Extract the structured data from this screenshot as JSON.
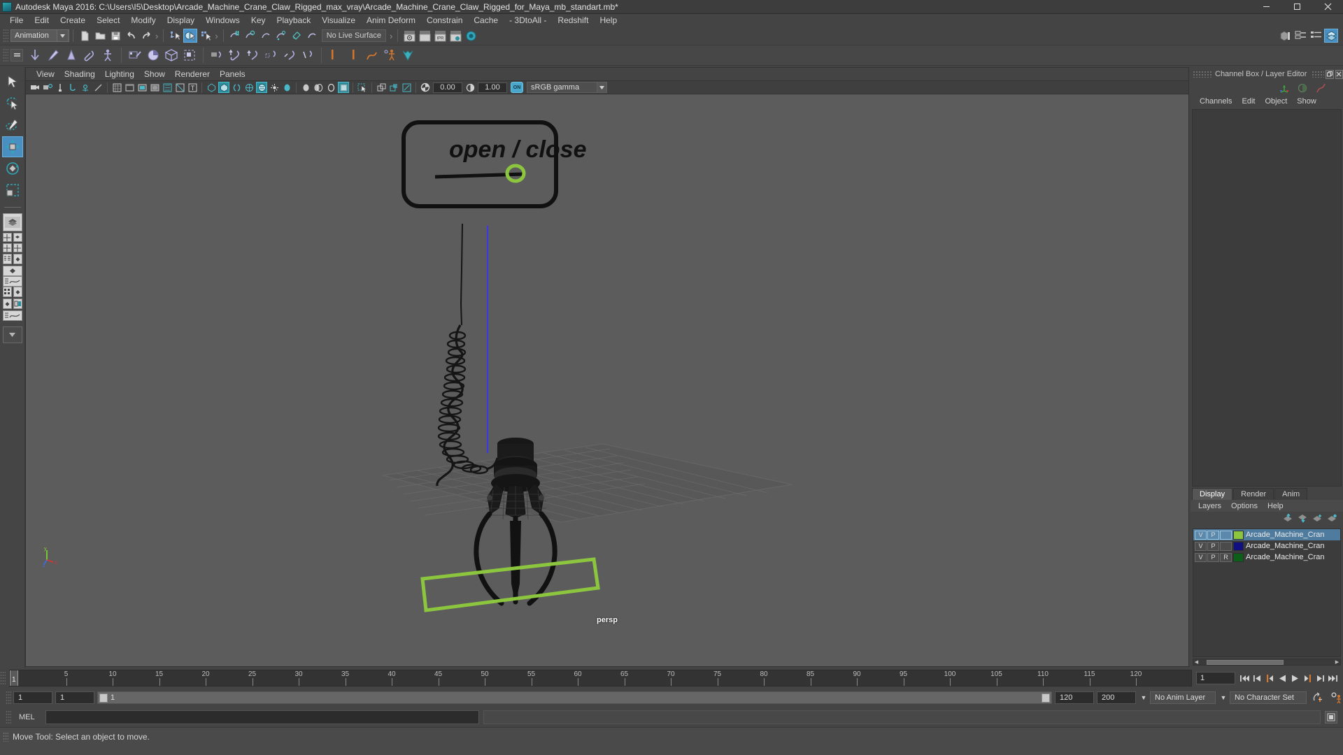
{
  "window": {
    "title": "Autodesk Maya 2016: C:\\Users\\I5\\Desktop\\Arcade_Machine_Crane_Claw_Rigged_max_vray\\Arcade_Machine_Crane_Claw_Rigged_for_Maya_mb_standart.mb*",
    "app_icon": "maya-logo-icon",
    "minimize_label": "–",
    "maximize_label": "❑",
    "close_label": "✕"
  },
  "menubar": {
    "items": [
      "File",
      "Edit",
      "Create",
      "Select",
      "Modify",
      "Display",
      "Windows",
      "Key",
      "Playback",
      "Visualize",
      "Anim Deform",
      "Constrain",
      "Cache",
      "- 3DtoAll -",
      "Redshift",
      "Help"
    ]
  },
  "toolbar": {
    "menu_set": "Animation",
    "live_surface": "No Live Surface",
    "file_icons": [
      "new-scene-icon",
      "open-scene-icon",
      "save-scene-icon",
      "undo-icon",
      "redo-icon"
    ],
    "select_mode_icons": [
      "select-by-hierarchy-icon",
      "select-by-object-icon",
      "select-by-component-icon"
    ],
    "snap_icons": [
      "snap-to-grid-icon",
      "snap-to-curve-icon",
      "snap-to-point-icon",
      "snap-to-projected-center-icon",
      "snap-to-view-plane-icon",
      "make-live-icon"
    ],
    "render_icons": [
      "render-current-frame-icon",
      "render-sequence-icon",
      "ipr-render-icon",
      "render-settings-icon",
      "hypershade-icon"
    ],
    "right_icons": [
      "show-hide-modeling-toolkit-icon",
      "show-hide-attribute-editor-icon",
      "show-hide-tool-settings-icon",
      "show-hide-channel-box-icon"
    ]
  },
  "shelf": {
    "tab_icon": "shelf-tabs-icon",
    "icons": [
      "move-down-arrow-icon",
      "paint-brush-icon",
      "cone-deform-icon",
      "clip-icon",
      "skeleton-icon",
      "set-key-icon",
      "pie-chart-icon",
      "cube-wire-icon",
      "bounding-box-icon",
      "parent-constraint-icon",
      "point-constraint-icon",
      "orient-constraint-icon",
      "scale-constraint-icon",
      "aim-constraint-icon",
      "pole-vector-icon",
      "ik-handle-icon",
      "joint-tool-icon",
      "ik-spline-icon",
      "bind-skin-icon",
      "paint-weights-icon",
      "mirror-weights-icon",
      "blend-shape-icon",
      "lattice-icon",
      "cluster-icon",
      "soft-mod-icon",
      "nonlinear-deform-icon",
      "wire-tool-icon",
      "quick-rig-icon",
      "humanik-icon",
      "character-set-icon"
    ]
  },
  "left_toolbox": {
    "items": [
      {
        "name": "select-tool",
        "selected": false
      },
      {
        "name": "lasso-select-tool",
        "selected": false
      },
      {
        "name": "paint-select-tool",
        "selected": false
      },
      {
        "name": "move-tool",
        "selected": true
      },
      {
        "name": "rotate-tool",
        "selected": false
      },
      {
        "name": "scale-tool",
        "selected": false
      }
    ],
    "layout_presets": [
      "single-perspective-layout",
      "four-view-layout",
      "two-panes-side-layout",
      "two-panes-stacked-layout",
      "outliner-persp-layout",
      "hypergraph-persp-layout",
      "persp-graph-editor-layout",
      "outliner-persp-graph-layout",
      "multi-layout",
      "persp-blank-layout",
      "saved-layouts-dropdown"
    ]
  },
  "viewport": {
    "menus": [
      "View",
      "Shading",
      "Lighting",
      "Show",
      "Renderer",
      "Panels"
    ],
    "camera_label": "persp",
    "exposure_value": "0.00",
    "gamma_value": "1.00",
    "color_management_toggle": "ON",
    "color_profile": "sRGB gamma",
    "toolbar_icons": [
      "select-camera-icon",
      "camera-attributes-icon",
      "bookmark-icon",
      "image-plane-icon",
      "two-sided-lighting-icon",
      "grid-toggle-icon",
      "film-gate-icon",
      "resolution-gate-icon",
      "gate-mask-icon",
      "film-origin-icon",
      "x-ray-icon",
      "text-icon",
      "wireframe-shading-icon",
      "smooth-shade-all-icon",
      "smooth-shade-selected-icon",
      "flat-shade-icon",
      "bounding-box-shade-icon",
      "textured-icon",
      "use-all-lights-icon",
      "shadows-icon",
      "ambient-occlusion-icon",
      "motion-blur-icon",
      "multisample-aa-icon",
      "depth-of-field-icon",
      "isolate-select-icon",
      "xray-joints-icon",
      "xray-active-components-icon",
      "exposure-icon",
      "gamma-icon"
    ],
    "annotation": {
      "label": "open / close",
      "shape": "rounded-rect-callout"
    },
    "axis_gizmo": {
      "x": "x",
      "y": "y",
      "z": "z"
    },
    "selection_color": "#9ACD32",
    "background_color": "#5c5c5c"
  },
  "channel_box": {
    "panel_title": "Channel Box / Layer Editor",
    "menus": [
      "Channels",
      "Edit",
      "Object",
      "Show"
    ],
    "restore_label": "❐",
    "close_label": "✕"
  },
  "layer_editor": {
    "tabs": [
      {
        "label": "Display",
        "active": true
      },
      {
        "label": "Render",
        "active": false
      },
      {
        "label": "Anim",
        "active": false
      }
    ],
    "menus": [
      "Layers",
      "Options",
      "Help"
    ],
    "toolbar_icons": [
      "move-layer-up-icon",
      "move-layer-down-icon",
      "new-layer-icon",
      "new-layer-from-selected-icon"
    ],
    "layers": [
      {
        "visibility": "V",
        "playback": "P",
        "state": "",
        "color": "#8CC63F",
        "name": "Arcade_Machine_Cran",
        "selected": true
      },
      {
        "visibility": "V",
        "playback": "P",
        "state": "",
        "color": "#101080",
        "name": "Arcade_Machine_Cran",
        "selected": false
      },
      {
        "visibility": "V",
        "playback": "P",
        "state": "R",
        "color": "#0B5F18",
        "name": "Arcade_Machine_Cran",
        "selected": false
      }
    ]
  },
  "time_slider": {
    "start_frame": "1",
    "end_frame": "120",
    "current_frame": "1",
    "tick_labels": [
      "5",
      "10",
      "15",
      "20",
      "25",
      "30",
      "35",
      "40",
      "45",
      "50",
      "55",
      "60",
      "65",
      "70",
      "75",
      "80",
      "85",
      "90",
      "95",
      "100",
      "105",
      "110",
      "115",
      "120"
    ],
    "playback_buttons": [
      "go-to-start-icon",
      "step-back-keyframe-icon",
      "step-back-frame-icon",
      "play-backwards-icon",
      "play-forwards-icon",
      "step-forward-frame-icon",
      "step-forward-keyframe-icon",
      "go-to-end-icon"
    ]
  },
  "range_slider": {
    "anim_start": "1",
    "range_start": "1",
    "range_bar_label": "1",
    "range_end": "120",
    "anim_end": "200",
    "playback_end_field": "120",
    "anim_layer": "No Anim Layer",
    "character_set": "No Character Set",
    "auto_key_icon": "auto-keyframe-icon",
    "animation_prefs_icon": "animation-preferences-icon"
  },
  "command_line": {
    "language_label": "MEL",
    "input_value": "",
    "output_value": "",
    "script_editor_icon": "script-editor-icon"
  },
  "status_bar": {
    "help_text": "Move Tool: Select an object to move."
  },
  "colors": {
    "accent_blue": "#4a90c4",
    "teal": "#2b8f9e",
    "panel_bg": "#444444",
    "viewport_bg": "#5c5c5c",
    "field_bg": "#2c2c2c",
    "selection_green": "#9ACD32",
    "orange": "#d4762c"
  }
}
